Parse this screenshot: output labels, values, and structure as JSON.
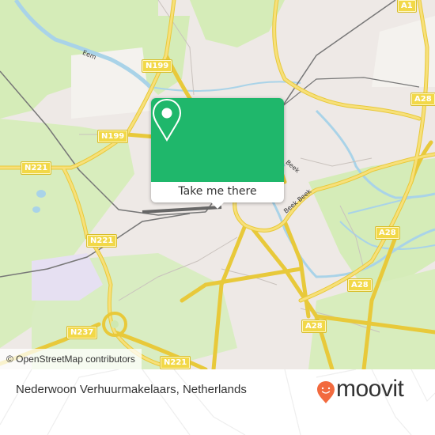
{
  "map": {
    "road_labels": [
      {
        "id": "n199-top",
        "text": "N199"
      },
      {
        "id": "n199-mid",
        "text": "N199"
      },
      {
        "id": "n221-west",
        "text": "N221"
      },
      {
        "id": "n221-mid",
        "text": "N221"
      },
      {
        "id": "n237",
        "text": "N237"
      },
      {
        "id": "n221-south",
        "text": "N221"
      },
      {
        "id": "a1",
        "text": "A1"
      },
      {
        "id": "a28-north",
        "text": "A28"
      },
      {
        "id": "a28-east",
        "text": "A28"
      },
      {
        "id": "a28-mid",
        "text": "A28"
      },
      {
        "id": "a28-south",
        "text": "A28"
      }
    ],
    "water_labels": [
      {
        "id": "eem",
        "text": "Eem"
      },
      {
        "id": "beek",
        "text": "Beek"
      },
      {
        "id": "beek2",
        "text": "Beek Beek"
      }
    ],
    "attribution": "© OpenStreetMap contributors",
    "colors": {
      "land": "#eee9e6",
      "green": "#d5ecb8",
      "water": "#a9d3e8",
      "road": "#f5d94a",
      "rail": "#777777"
    }
  },
  "popup": {
    "icon": "map-pin-icon",
    "action_label": "Take me there",
    "accent_color": "#1fb76b"
  },
  "footer": {
    "place_name": "Nederwoon Verhuurmakelaars, Netherlands",
    "brand": "moovit",
    "brand_color": "#f26a3e"
  }
}
